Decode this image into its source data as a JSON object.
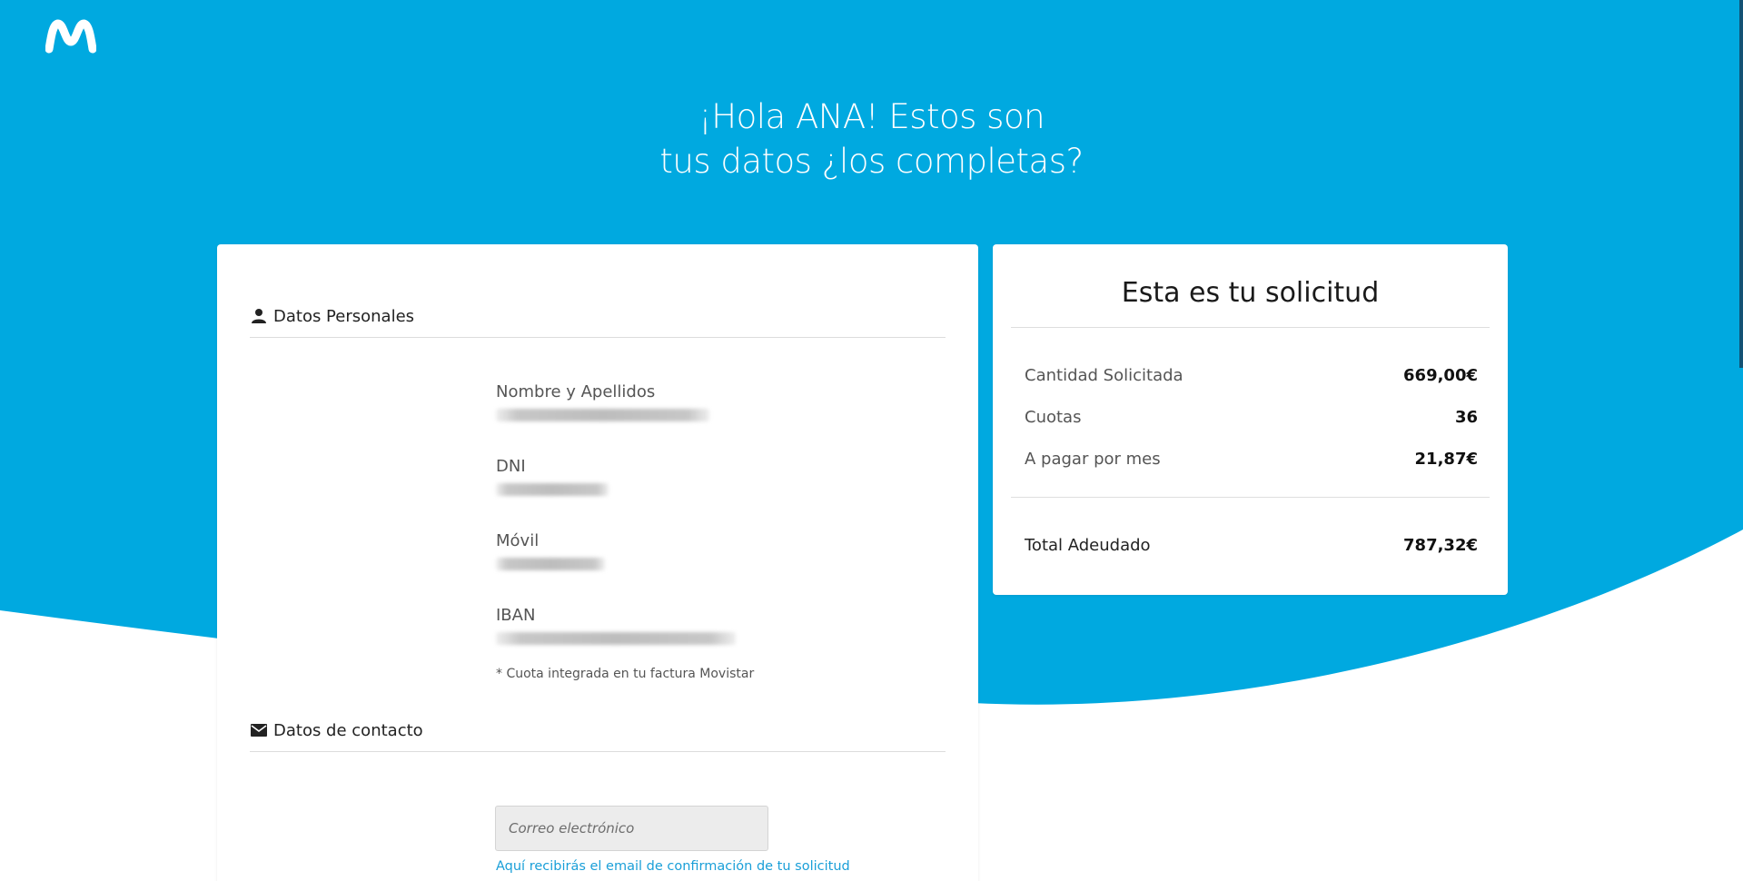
{
  "brand": {
    "logo": "movistar-m-logo",
    "primary_color": "#00a9e0",
    "link_color": "#1a9fd8"
  },
  "hero": {
    "line1": "¡Hola ANA! Estos son",
    "line2": "tus datos ¿los completas?"
  },
  "personal": {
    "section_title": "Datos Personales",
    "icon": "person-icon",
    "fields": [
      {
        "label": "Nombre y Apellidos"
      },
      {
        "label": "DNI"
      },
      {
        "label": "Móvil"
      },
      {
        "label": "IBAN"
      }
    ],
    "note": "* Cuota integrada en tu factura Movistar"
  },
  "contact": {
    "section_title": "Datos de contacto",
    "icon": "mail-icon",
    "email_placeholder": "Correo electrónico",
    "email_value": "",
    "email_hint": "Aquí recibirás el email de confirmación de tu solicitud"
  },
  "summary": {
    "title": "Esta es tu solicitud",
    "rows": [
      {
        "label": "Cantidad Solicitada",
        "value": "669,00€"
      },
      {
        "label": "Cuotas",
        "value": "36"
      },
      {
        "label": "A pagar por mes",
        "value": "21,87€"
      }
    ],
    "total_label": "Total Adeudado",
    "total_value": "787,32€"
  }
}
